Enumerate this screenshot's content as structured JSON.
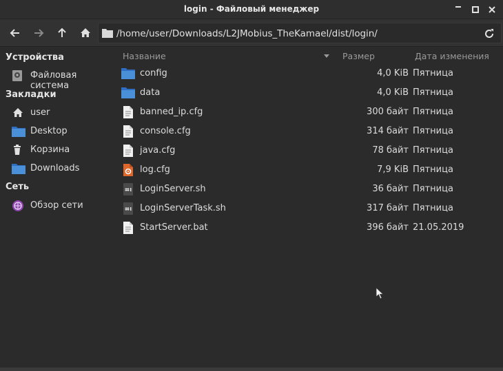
{
  "window": {
    "title": "login - Файловый менеджер",
    "minimize_glyph": "▁",
    "maximize_glyph": "▫",
    "close_glyph": "✕"
  },
  "toolbar": {
    "path": "/home/user/Downloads/L2JMobius_TheKamael/dist/login/"
  },
  "sidebar": {
    "sections": [
      {
        "title": "Устройства",
        "items": [
          {
            "label": "Файловая система",
            "icon": "drive-icon"
          }
        ]
      },
      {
        "title": "Закладки",
        "items": [
          {
            "label": "user",
            "icon": "home-icon"
          },
          {
            "label": "Desktop",
            "icon": "desktop-icon"
          },
          {
            "label": "Корзина",
            "icon": "trash-icon"
          },
          {
            "label": "Downloads",
            "icon": "folder-icon"
          }
        ]
      },
      {
        "title": "Сеть",
        "items": [
          {
            "label": "Обзор сети",
            "icon": "network-icon"
          }
        ]
      }
    ]
  },
  "list": {
    "columns": {
      "name": "Название",
      "size": "Размер",
      "date": "Дата изменения"
    },
    "files": [
      {
        "name": "config",
        "size": "4,0 KiB",
        "date": "Пятница",
        "icon": "folder-icon"
      },
      {
        "name": "data",
        "size": "4,0 KiB",
        "date": "Пятница",
        "icon": "folder-icon"
      },
      {
        "name": "banned_ip.cfg",
        "size": "300 байт",
        "date": "Пятница",
        "icon": "text-file-icon"
      },
      {
        "name": "console.cfg",
        "size": "314 байт",
        "date": "Пятница",
        "icon": "text-file-icon"
      },
      {
        "name": "java.cfg",
        "size": "78 байт",
        "date": "Пятница",
        "icon": "text-file-icon"
      },
      {
        "name": "log.cfg",
        "size": "7,9 KiB",
        "date": "Пятница",
        "icon": "config-file-icon"
      },
      {
        "name": "LoginServer.sh",
        "size": "36 байт",
        "date": "Пятница",
        "icon": "script-file-icon"
      },
      {
        "name": "LoginServerTask.sh",
        "size": "317 байт",
        "date": "Пятница",
        "icon": "script-file-icon"
      },
      {
        "name": "StartServer.bat",
        "size": "396 байт",
        "date": "21.05.2019",
        "icon": "text-file-icon"
      }
    ]
  },
  "colors": {
    "folder": "#4a90d9",
    "accent_orange": "#e0672c",
    "network": "#8e44ad"
  }
}
